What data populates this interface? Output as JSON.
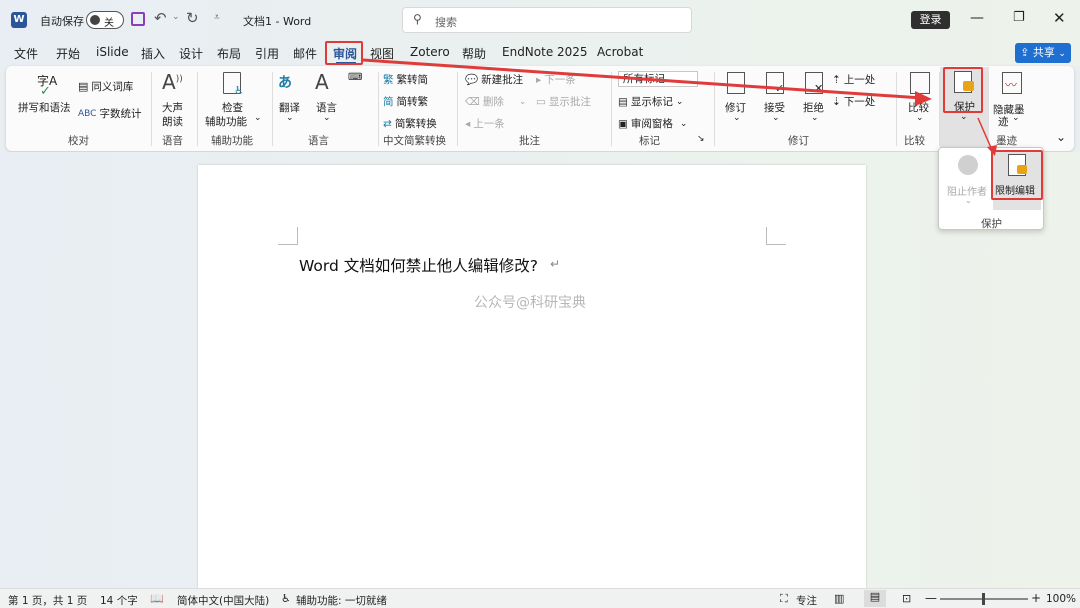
{
  "titlebar": {
    "autosave_label": "自动保存",
    "autosave_state": "关",
    "doc_title": "文档1 - Word",
    "search_placeholder": "搜索",
    "login_label": "登录"
  },
  "menu": {
    "tabs": [
      "文件",
      "开始",
      "iSlide",
      "插入",
      "设计",
      "布局",
      "引用",
      "邮件",
      "审阅",
      "视图",
      "Zotero",
      "帮助",
      "EndNote 2025",
      "Acrobat"
    ],
    "share_label": "共享"
  },
  "ribbon": {
    "proofing": {
      "spelling": "拼写和语法",
      "thesaurus": "同义词库",
      "wordcount": "字数统计",
      "group": "校对"
    },
    "speech": {
      "read_aloud_1": "大声",
      "read_aloud_2": "朗读",
      "group": "语音"
    },
    "accessibility": {
      "check_1": "检查",
      "check_2": "辅助功能",
      "group": "辅助功能"
    },
    "language": {
      "translate": "翻译",
      "language": "语言",
      "group": "语言"
    },
    "chinese": {
      "to_simplified": "繁转简",
      "to_traditional": "简转繁",
      "convert": "简繁转换",
      "group": "中文简繁转换"
    },
    "comments": {
      "new": "新建批注",
      "delete": "删除",
      "prev": "上一条",
      "next": "下一条",
      "show": "显示批注",
      "group": "批注"
    },
    "tracking": {
      "all_markup": "所有标记",
      "show_markup": "显示标记",
      "review_pane": "审阅窗格",
      "group": "标记"
    },
    "changes": {
      "track": "修订",
      "accept": "接受",
      "reject": "拒绝",
      "prev": "上一处",
      "next": "下一处",
      "group": "修订"
    },
    "compare": {
      "compare": "比较",
      "group": "比较"
    },
    "protect": {
      "protect": "保护",
      "group": "保护"
    },
    "ink": {
      "hide_ink_1": "隐藏墨",
      "hide_ink_2": "迹",
      "group": "墨迹"
    }
  },
  "protect_dropdown": {
    "block_authors": "阻止作者",
    "restrict_editing": "限制编辑",
    "group": "保护"
  },
  "document": {
    "heading": "Word 文档如何禁止他人编辑修改?",
    "watermark": "公众号@科研宝典"
  },
  "status": {
    "page": "第 1 页，共 1 页",
    "words": "14 个字",
    "language": "简体中文(中国大陆)",
    "accessibility": "辅助功能: 一切就绪",
    "focus": "专注",
    "zoom": "100%"
  },
  "colors": {
    "accent": "#2b579a",
    "highlight": "#e03b3b",
    "share": "#1f6fd1"
  }
}
